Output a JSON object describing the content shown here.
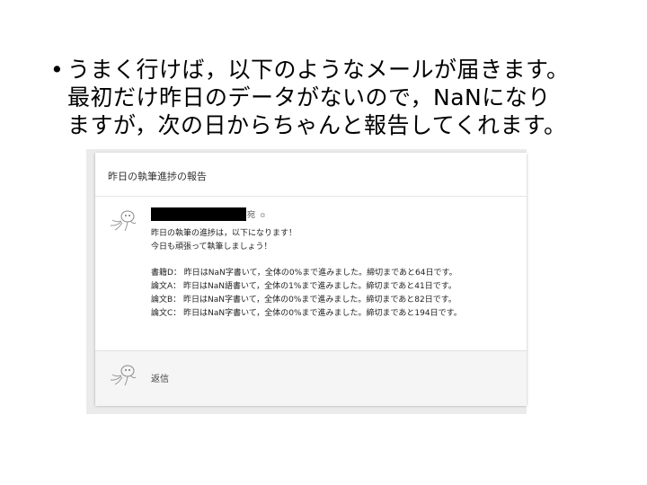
{
  "slide": {
    "bullet": "•",
    "lines": [
      "うまく行けば，以下のようなメールが届きます。",
      "最初だけ昨日のデータがないので，NaNになり",
      "ますが，次の日からちゃんと報告してくれます。"
    ]
  },
  "email": {
    "subject": "昨日の執筆進捗の報告",
    "sender_suffix": "宛",
    "sender_caret": "≎",
    "greeting": [
      "昨日の執筆の進捗は，以下になります！",
      "今日も頑張って執筆しましょう！"
    ],
    "report": [
      "書籍D： 昨日はNaN字書いて，全体の0%まで進みました。締切まであと64日です。",
      "論文A： 昨日はNaN語書いて，全体の1%まで進みました。締切まであと41日です。",
      "論文B： 昨日はNaN字書いて，全体の0%まで進みました。締切まであと82日です。",
      "論文C： 昨日はNaN字書いて，全体の0%まで進みました。締切まであと194日です。"
    ],
    "reply_label": "返信"
  },
  "icons": {
    "avatar": "doodle-avatar-icon",
    "caret": "chevron-updown-icon"
  }
}
